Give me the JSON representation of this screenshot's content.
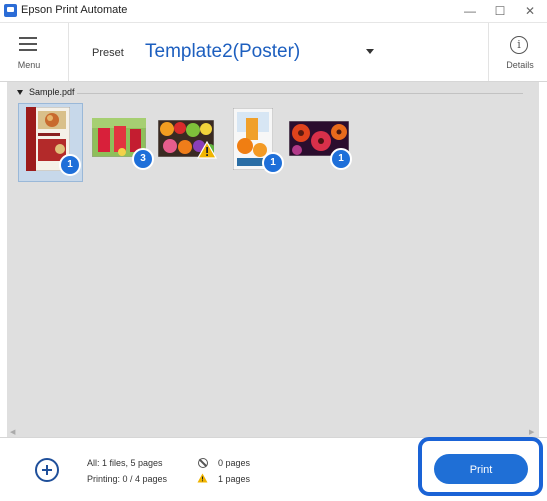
{
  "window": {
    "title": "Epson Print Automate",
    "minimize_glyph": "—",
    "maximize_glyph": "☐",
    "close_glyph": "✕"
  },
  "toolbar": {
    "menu_label": "Menu",
    "preset_label": "Preset",
    "preset_value": "Template2(Poster)",
    "details_label": "Details",
    "details_glyph": "i"
  },
  "content": {
    "group_name": "Sample.pdf",
    "thumbnails": [
      {
        "name": "thumbnail-1-cookbook",
        "badge": "1",
        "selected": true,
        "warning": false
      },
      {
        "name": "thumbnail-2-drinks",
        "badge": "3",
        "selected": false,
        "warning": false
      },
      {
        "name": "thumbnail-3-fruits",
        "badge": "",
        "selected": false,
        "warning": true
      },
      {
        "name": "thumbnail-4-juice",
        "badge": "1",
        "selected": false,
        "warning": false
      },
      {
        "name": "thumbnail-5-flowers",
        "badge": "1",
        "selected": false,
        "warning": false
      }
    ]
  },
  "status": {
    "all_files": "All: 1 files, 5 pages",
    "printing": "Printing: 0 / 4 pages",
    "skipped_pages": "0 pages",
    "warning_pages": "1 pages"
  },
  "actions": {
    "print_label": "Print"
  },
  "colors": {
    "accent": "#1f6fd6",
    "highlight": "#1a63d6",
    "content_bg": "#dfdfdf",
    "warning": "#f0b400"
  }
}
